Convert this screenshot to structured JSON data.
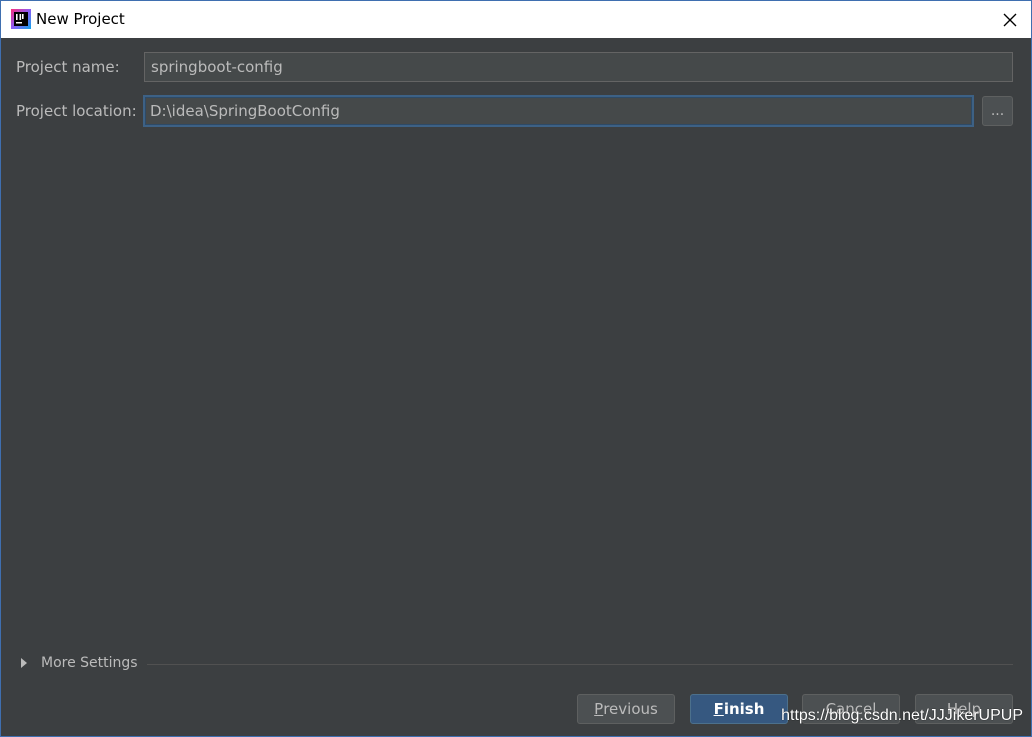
{
  "window": {
    "title": "New Project",
    "close_symbol": "✕"
  },
  "form": {
    "project_name_label": "Project name:",
    "project_name_value": "springboot-config",
    "project_location_label": "Project location:",
    "project_location_value": "D:\\idea\\SpringBootConfig",
    "browse_label": "..."
  },
  "more_settings": {
    "label": "More Settings"
  },
  "buttons": {
    "previous_mnemonic": "P",
    "previous_rest": "revious",
    "finish_mnemonic": "F",
    "finish_rest": "inish",
    "cancel_label": "Cancel",
    "help_label": "Help"
  },
  "watermark": {
    "text": "https://blog.csdn.net/JJJikerUPUP"
  },
  "colors": {
    "background": "#3c3f41",
    "primary_button": "#365880",
    "focus_border": "#3d6185"
  },
  "icons": {
    "app": "intellij-idea-icon",
    "close": "close-icon",
    "expand": "triangle-right-icon"
  }
}
